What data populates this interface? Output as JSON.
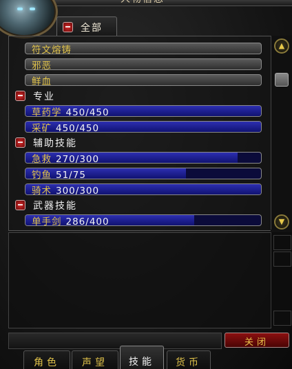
{
  "window": {
    "title": "人物信息"
  },
  "filter_tab": {
    "label": "全部"
  },
  "skills": {
    "unlabeled_rows": [
      {
        "name": "符文熔铸"
      },
      {
        "name": "邪恶"
      },
      {
        "name": "鲜血"
      }
    ],
    "categories": [
      {
        "name": "专业",
        "skills": [
          {
            "name": "草药学",
            "value": "450/450",
            "fill": 1.0
          },
          {
            "name": "采矿",
            "value": "450/450",
            "fill": 1.0
          }
        ]
      },
      {
        "name": "辅助技能",
        "skills": [
          {
            "name": "急救",
            "value": "270/300",
            "fill": 0.9
          },
          {
            "name": "钓鱼",
            "value": "51/75",
            "fill": 0.68
          },
          {
            "name": "骑术",
            "value": "300/300",
            "fill": 1.0
          }
        ]
      },
      {
        "name": "武器技能",
        "skills": [
          {
            "name": "单手剑",
            "value": "286/400",
            "fill": 0.715
          }
        ]
      }
    ]
  },
  "close_button": {
    "label": "关闭"
  },
  "tabs": [
    {
      "label": "角色",
      "active": false
    },
    {
      "label": "声望",
      "active": false
    },
    {
      "label": "技能",
      "active": true
    },
    {
      "label": "货币",
      "active": false
    }
  ],
  "icons": {
    "scroll_up": "scroll-up-icon",
    "scroll_down": "scroll-down-icon",
    "collapse": "minus-icon"
  },
  "colors": {
    "gold_text": "#e0c24a",
    "bar_blue": "#2d2fb0",
    "close_red": "#8c1010"
  }
}
